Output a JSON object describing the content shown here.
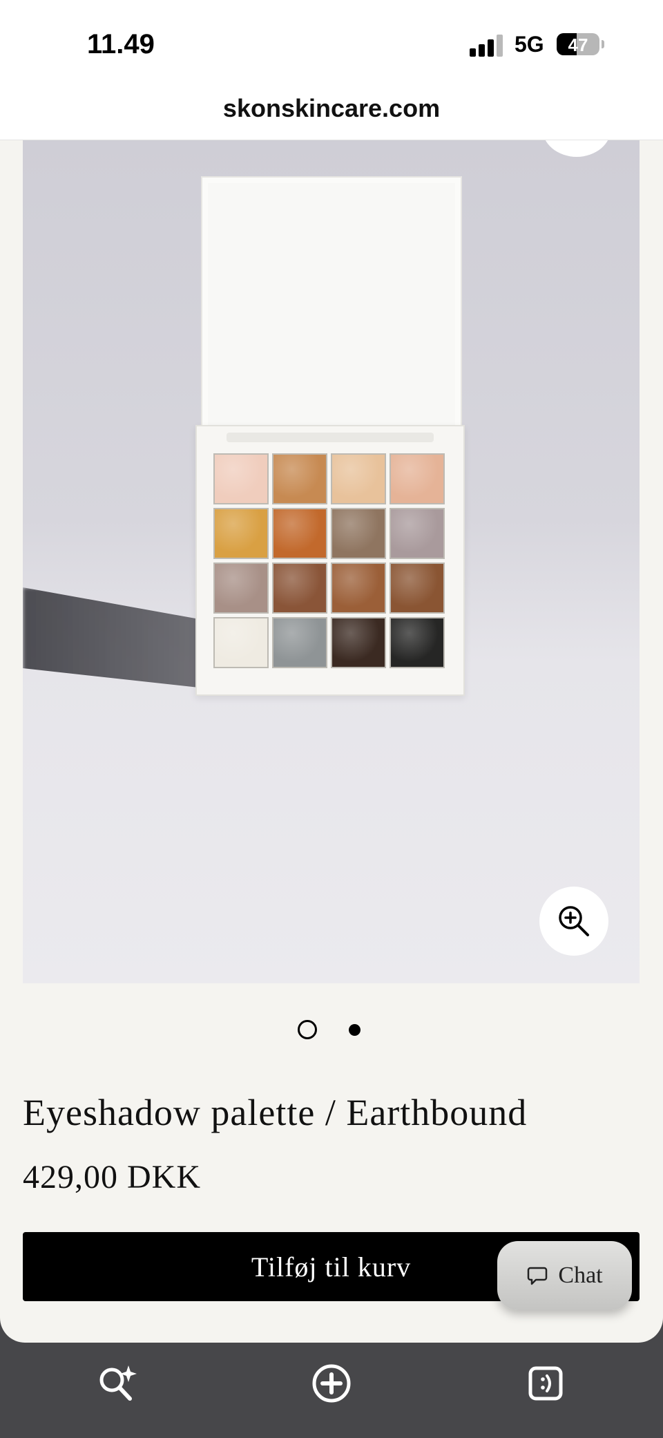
{
  "status_bar": {
    "time": "11.49",
    "network": "5G",
    "battery": "47",
    "battery_level": 0.47,
    "icons": [
      "signal-icon",
      "battery-icon"
    ]
  },
  "browser": {
    "url": "skonskincare.com"
  },
  "product": {
    "image_icon": "zoom-in-icon",
    "palette_colors": [
      "#f0cdbd",
      "#c78a52",
      "#e8c29b",
      "#e5b397",
      "#d9a043",
      "#c2692c",
      "#8f7560",
      "#a99a9c",
      "#a89087",
      "#8a5538",
      "#9b5f38",
      "#8a5533",
      "#efebe2",
      "#8f9496",
      "#3b2a22",
      "#262625"
    ],
    "carousel": {
      "count": 2,
      "active_index": 1
    },
    "title": "Eyeshadow palette / Earthbound",
    "price": "429,00 DKK",
    "add_to_cart_label": "Tilføj til kurv"
  },
  "chat": {
    "label": "Chat",
    "icon": "chat-bubble-icon"
  },
  "toolbar": {
    "icons": [
      "search-sparkle-icon",
      "add-circle-icon",
      "tab-switcher-icon"
    ]
  },
  "colors": {
    "page_background": "#f5f4f0",
    "button_background": "#000000",
    "toolbar_background": "#47474a"
  }
}
